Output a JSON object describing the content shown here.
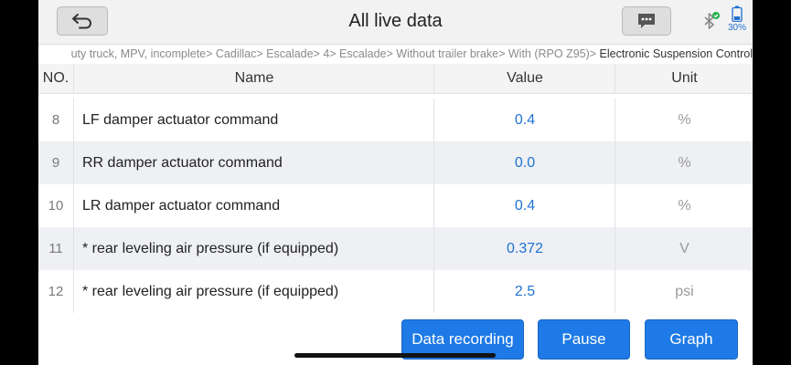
{
  "header": {
    "title": "All live data",
    "battery_level": "30%",
    "colors": {
      "accent": "#1e7ae6",
      "value_text": "#1f73d6"
    }
  },
  "breadcrumb": {
    "trail": "uty truck, MPV, incomplete> Cadillac> Escalade> 4> Escalade> Without trailer brake> With (RPO Z95)> ",
    "current": "Electronic Suspension Control"
  },
  "table": {
    "columns": {
      "no": "NO.",
      "name": "Name",
      "value": "Value",
      "unit": "Unit"
    },
    "rows": [
      {
        "no": "8",
        "name": "LF damper actuator command",
        "value": "0.4",
        "unit": "%"
      },
      {
        "no": "9",
        "name": "RR damper actuator command",
        "value": "0.0",
        "unit": "%"
      },
      {
        "no": "10",
        "name": "LR damper actuator command",
        "value": "0.4",
        "unit": "%"
      },
      {
        "no": "11",
        "name": "* rear leveling air pressure (if equipped)",
        "value": "0.372",
        "unit": "V"
      },
      {
        "no": "12",
        "name": "* rear leveling air pressure (if equipped)",
        "value": "2.5",
        "unit": "psi"
      }
    ]
  },
  "actions": {
    "data_recording": "Data recording",
    "pause": "Pause",
    "graph": "Graph"
  },
  "icons": {
    "back": "back-arrow-icon",
    "message": "message-icon",
    "bluetooth": "bluetooth-icon",
    "battery": "battery-icon"
  }
}
